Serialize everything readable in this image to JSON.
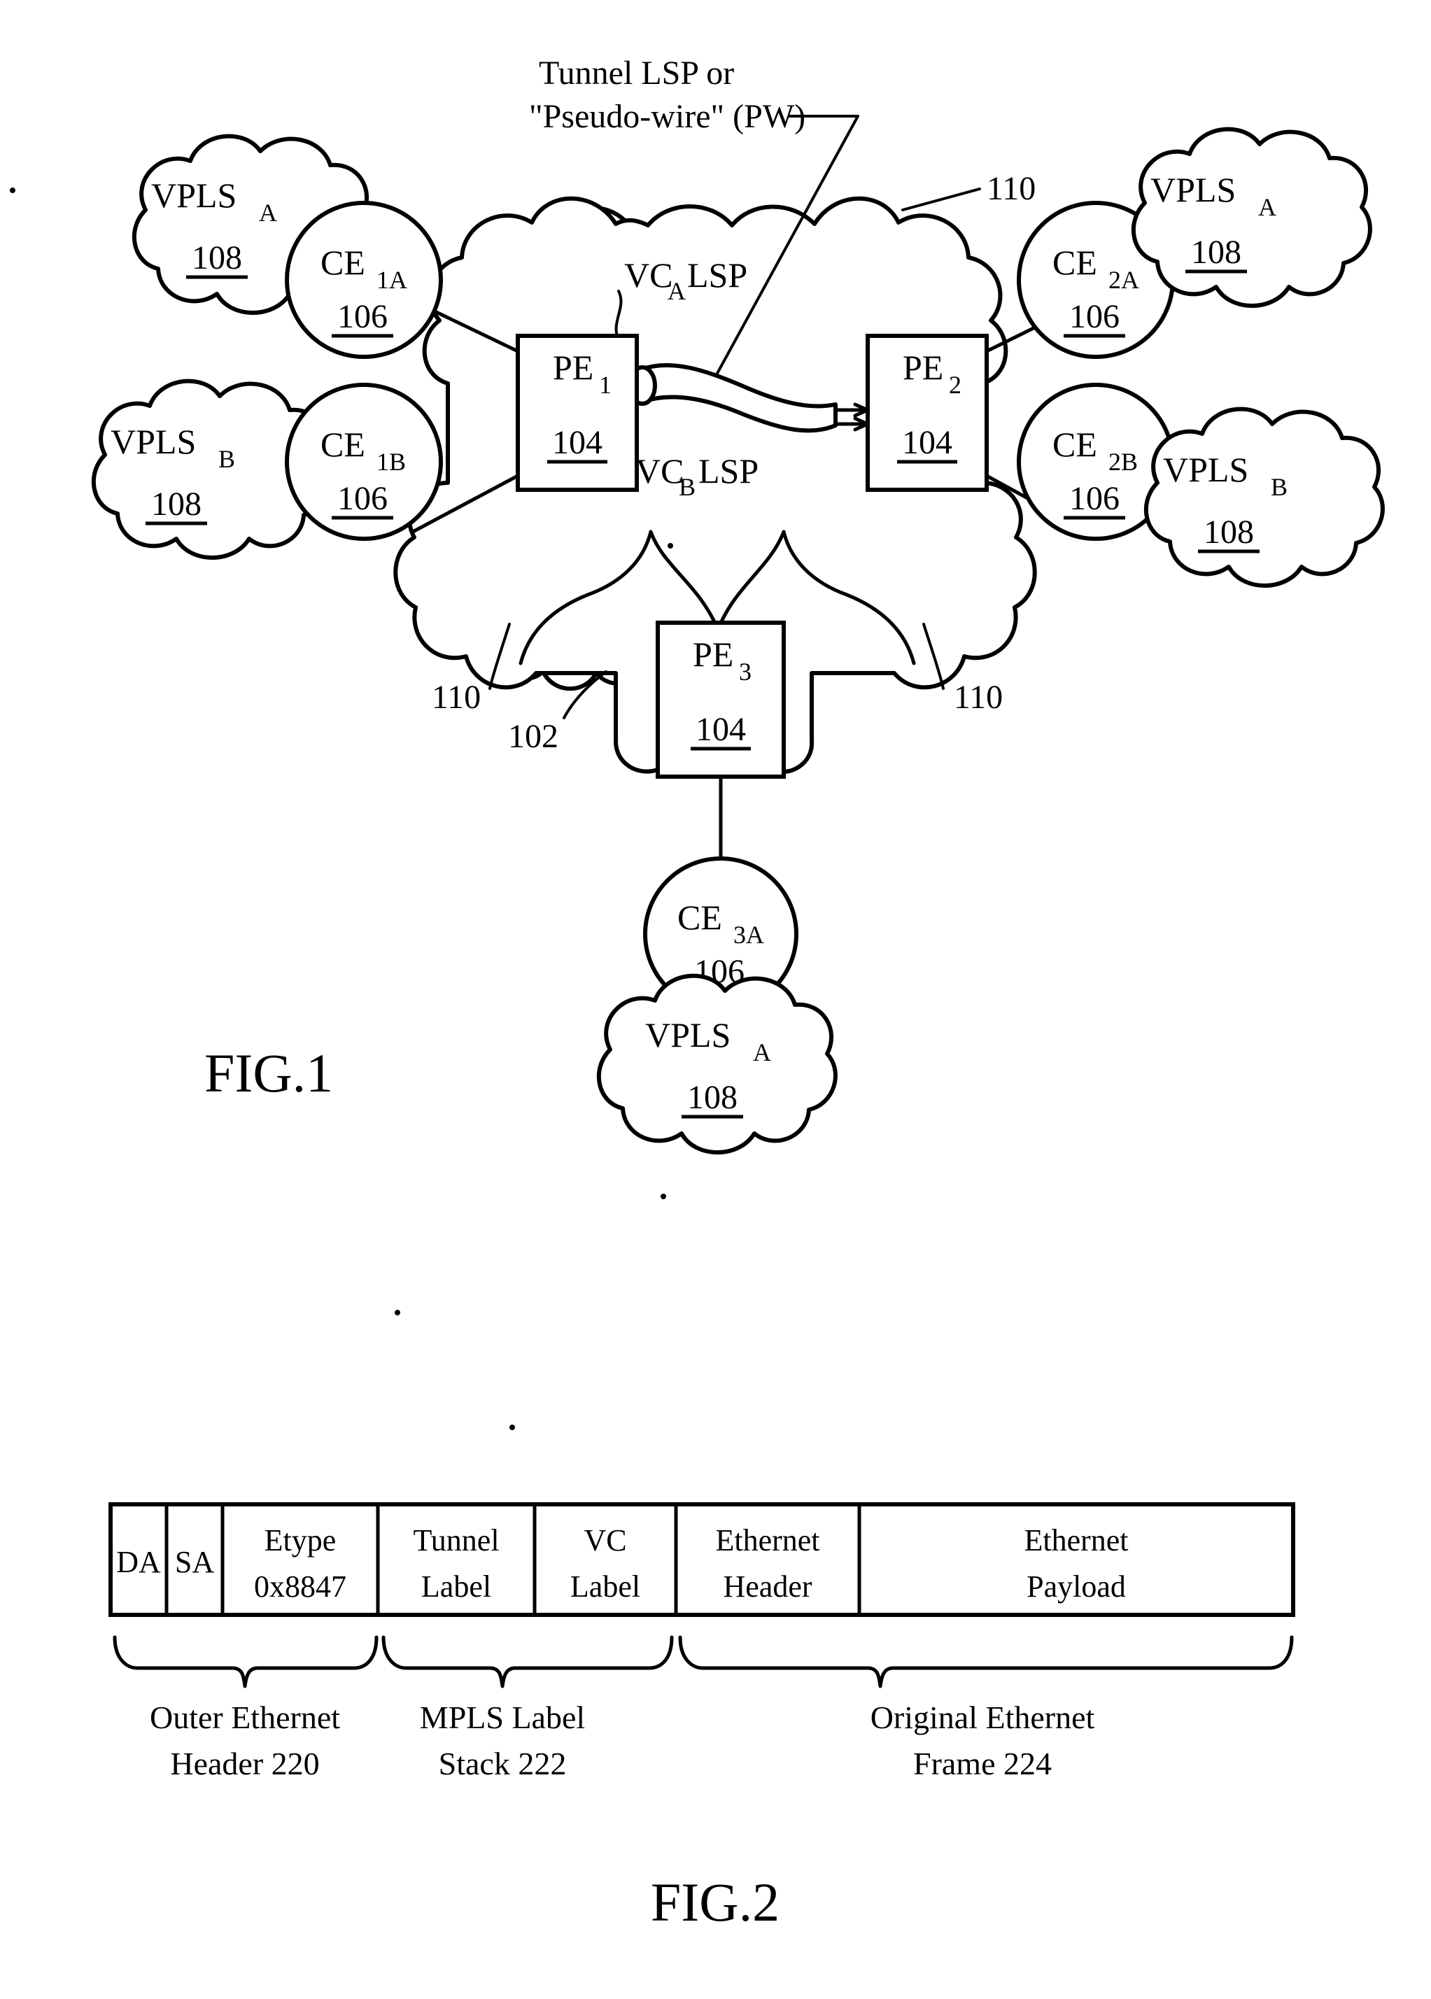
{
  "figures": {
    "fig1": {
      "title": "FIG.1",
      "callout": {
        "line1": "Tunnel LSP or",
        "line2": "\"Pseudo-wire\" (PW)"
      },
      "lsp_labels": {
        "vca": "VC",
        "vca_sub": "A",
        "vca_tail": " LSP",
        "vcb": "VC",
        "vcb_sub": "B",
        "vcb_tail": " LSP"
      },
      "pe_nodes": [
        {
          "name": "PE",
          "sub": "1",
          "ref": "104"
        },
        {
          "name": "PE",
          "sub": "2",
          "ref": "104"
        },
        {
          "name": "PE",
          "sub": "3",
          "ref": "104"
        }
      ],
      "ce_nodes": [
        {
          "name": "CE",
          "sub": "1A",
          "ref": "106"
        },
        {
          "name": "CE",
          "sub": "1B",
          "ref": "106"
        },
        {
          "name": "CE",
          "sub": "2A",
          "ref": "106"
        },
        {
          "name": "CE",
          "sub": "2B",
          "ref": "106"
        },
        {
          "name": "CE",
          "sub": "3A",
          "ref": "106"
        }
      ],
      "vpls_clouds": [
        {
          "name": "VPLS",
          "sub": "A",
          "ref": "108"
        },
        {
          "name": "VPLS",
          "sub": "B",
          "ref": "108"
        },
        {
          "name": "VPLS",
          "sub": "A",
          "ref": "108"
        },
        {
          "name": "VPLS",
          "sub": "B",
          "ref": "108"
        },
        {
          "name": "VPLS",
          "sub": "A",
          "ref": "108"
        }
      ],
      "ref_numbers": {
        "network": "102",
        "pe_ref": "104",
        "ce_ref": "106",
        "vpls_ref": "108",
        "link_ref": "110",
        "link_ref_1": "110",
        "link_ref_2": "110",
        "link_ref_3": "110",
        "link_ref_4": "110"
      }
    },
    "fig2": {
      "title": "FIG.2",
      "cells": [
        {
          "line1": "DA",
          "line2": ""
        },
        {
          "line1": "SA",
          "line2": ""
        },
        {
          "line1": "Etype",
          "line2": "0x8847"
        },
        {
          "line1": "Tunnel",
          "line2": "Label"
        },
        {
          "line1": "VC",
          "line2": "Label"
        },
        {
          "line1": "Ethernet",
          "line2": "Header"
        },
        {
          "line1": "Ethernet",
          "line2": "Payload"
        }
      ],
      "groups": [
        {
          "line1": "Outer Ethernet",
          "line2": "Header 220"
        },
        {
          "line1": "MPLS Label",
          "line2": "Stack 222"
        },
        {
          "line1": "Original Ethernet",
          "line2": "Frame 224"
        }
      ]
    }
  },
  "colors": {
    "ink": "#000000",
    "paper": "#ffffff"
  }
}
